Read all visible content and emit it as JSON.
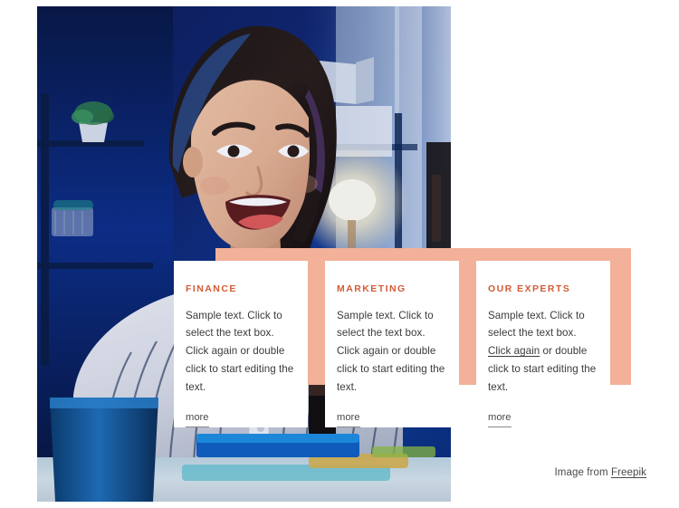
{
  "palette": {
    "accent_peach": "#F2B198",
    "heading_orange": "#D25B37",
    "body_text": "#3B3B3B",
    "more_text": "#4A4A4A",
    "credit_text": "#4A4A4A",
    "card_bg": "#FFFFFF",
    "page_bg": "#FFFFFF"
  },
  "hero": {
    "image_alt": "Smiling young woman in a striped shirt at a desk in a blue-lit office",
    "image_name": "hero-photo"
  },
  "accent": {
    "name": "peach-accent-block"
  },
  "cards": [
    {
      "title": "FINANCE",
      "body_before": "Sample text. Click to select the text box. Click again or double click to start editing the text.",
      "link_text": "",
      "body_after": "",
      "more_label": "more"
    },
    {
      "title": "MARKETING",
      "body_before": "Sample text. Click to select the text box. Click again or double click to start editing the text.",
      "link_text": "",
      "body_after": "",
      "more_label": "more"
    },
    {
      "title": "OUR EXPERTS",
      "body_before": "Sample text. Click to select the text box. ",
      "link_text": "Click again",
      "body_after": " or double click to start editing the text.",
      "more_label": "more"
    }
  ],
  "credit": {
    "prefix": "Image from ",
    "link_label": "Freepik"
  }
}
